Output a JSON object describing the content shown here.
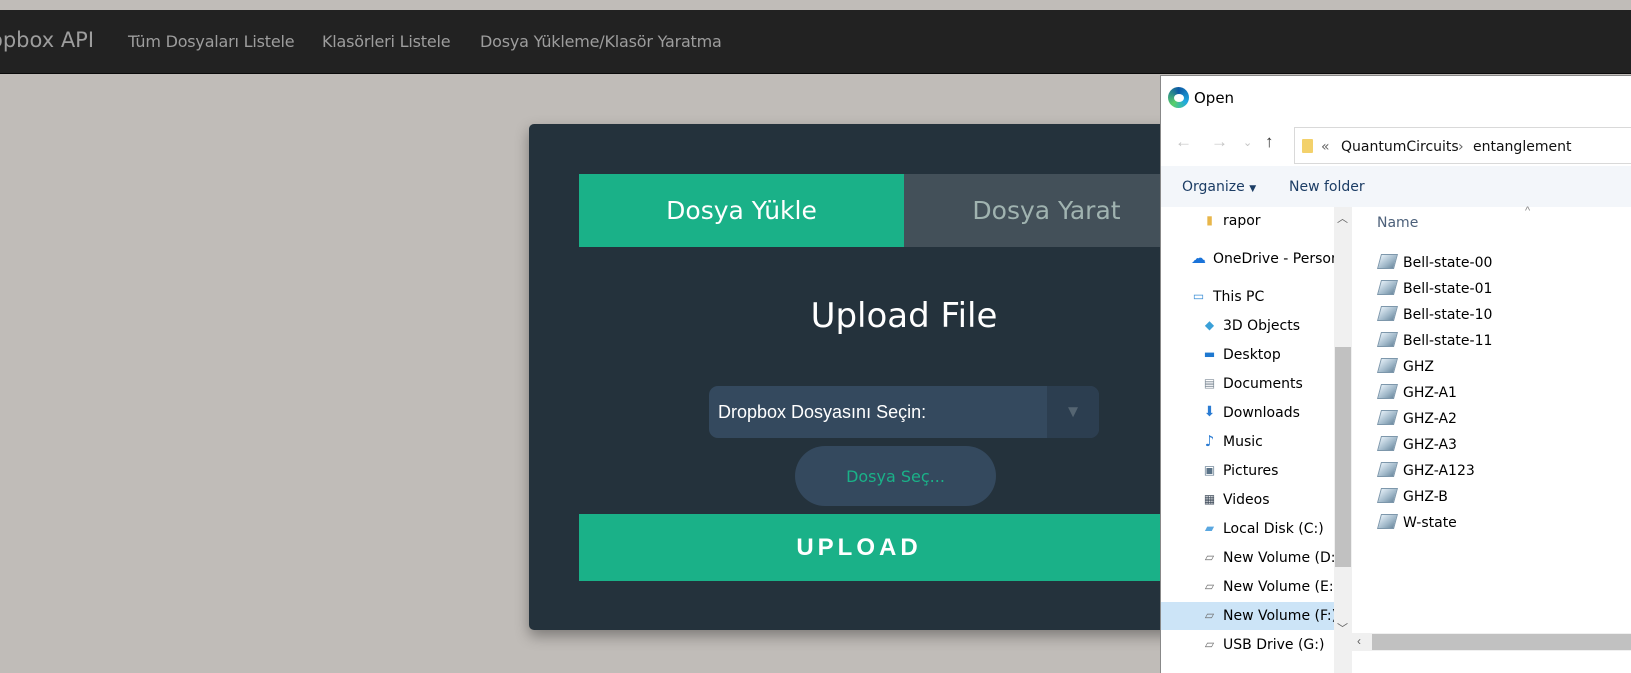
{
  "navbar": {
    "brand": "opbox API",
    "links": [
      "Tüm Dosyaları Listele",
      "Klasörleri Listele",
      "Dosya Yükleme/Klasör Yaratma"
    ]
  },
  "panel": {
    "tabs": [
      "Dosya Yükle",
      "Dosya Yarat"
    ],
    "title": "Upload File",
    "select_label": "Dropbox Dosyasını Seçin:",
    "select_arrow": "▼",
    "choose_label": "Dosya Seç...",
    "upload_label": "UPLOAD"
  },
  "dialog": {
    "title": "Open",
    "path_chevron": "«",
    "path": [
      "QuantumCircuits",
      "entanglement"
    ],
    "path_separator": "›",
    "toolbar": {
      "organize": "Organize",
      "new_folder": "New folder"
    },
    "tree": [
      {
        "label": "rapor",
        "icon": "folder-icon"
      },
      {
        "label": "OneDrive - Person",
        "icon": "cloud-icon"
      },
      {
        "label": "This PC",
        "icon": "computer-icon"
      },
      {
        "label": "3D Objects",
        "icon": "cube-icon"
      },
      {
        "label": "Desktop",
        "icon": "desktop-icon"
      },
      {
        "label": "Documents",
        "icon": "document-icon"
      },
      {
        "label": "Downloads",
        "icon": "download-icon"
      },
      {
        "label": "Music",
        "icon": "music-icon"
      },
      {
        "label": "Pictures",
        "icon": "picture-icon"
      },
      {
        "label": "Videos",
        "icon": "video-icon"
      },
      {
        "label": "Local Disk (C:)",
        "icon": "drive-icon"
      },
      {
        "label": "New Volume (D:)",
        "icon": "drive-icon"
      },
      {
        "label": "New Volume (E:)",
        "icon": "drive-icon"
      },
      {
        "label": "New Volume (F:)",
        "icon": "drive-icon"
      },
      {
        "label": "USB Drive (G:)",
        "icon": "usb-icon"
      }
    ],
    "column_header": "Name",
    "files": [
      "Bell-state-00",
      "Bell-state-01",
      "Bell-state-10",
      "Bell-state-11",
      "GHZ",
      "GHZ-A1",
      "GHZ-A2",
      "GHZ-A3",
      "GHZ-A123",
      "GHZ-B",
      "W-state"
    ]
  },
  "colors": {
    "navbar": "#222222",
    "accent": "#1ab188",
    "panel": "#24323c",
    "background": "#c0bcb8"
  }
}
